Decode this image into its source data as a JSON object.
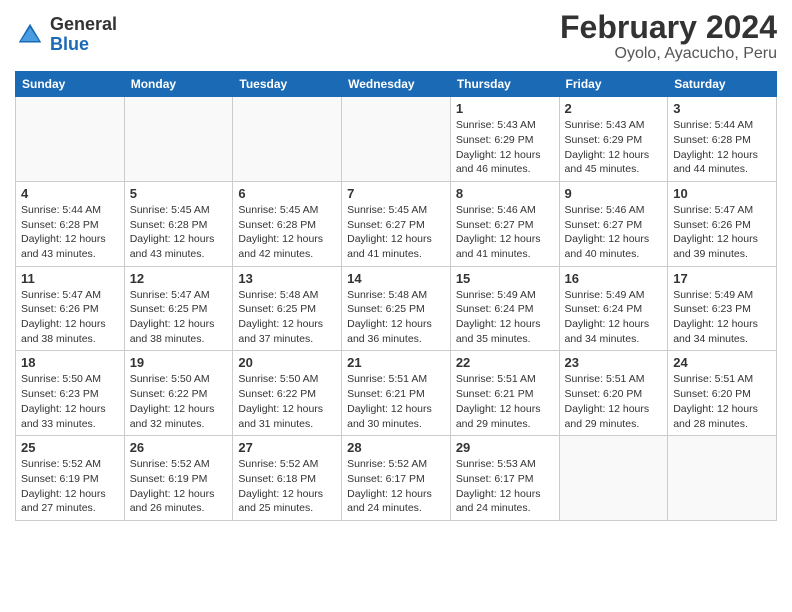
{
  "header": {
    "logo": {
      "general": "General",
      "blue": "Blue"
    },
    "title": "February 2024",
    "subtitle": "Oyolo, Ayacucho, Peru"
  },
  "calendar": {
    "weekdays": [
      "Sunday",
      "Monday",
      "Tuesday",
      "Wednesday",
      "Thursday",
      "Friday",
      "Saturday"
    ],
    "weeks": [
      [
        {
          "day": "",
          "info": ""
        },
        {
          "day": "",
          "info": ""
        },
        {
          "day": "",
          "info": ""
        },
        {
          "day": "",
          "info": ""
        },
        {
          "day": "1",
          "info": "Sunrise: 5:43 AM\nSunset: 6:29 PM\nDaylight: 12 hours\nand 46 minutes."
        },
        {
          "day": "2",
          "info": "Sunrise: 5:43 AM\nSunset: 6:29 PM\nDaylight: 12 hours\nand 45 minutes."
        },
        {
          "day": "3",
          "info": "Sunrise: 5:44 AM\nSunset: 6:28 PM\nDaylight: 12 hours\nand 44 minutes."
        }
      ],
      [
        {
          "day": "4",
          "info": "Sunrise: 5:44 AM\nSunset: 6:28 PM\nDaylight: 12 hours\nand 43 minutes."
        },
        {
          "day": "5",
          "info": "Sunrise: 5:45 AM\nSunset: 6:28 PM\nDaylight: 12 hours\nand 43 minutes."
        },
        {
          "day": "6",
          "info": "Sunrise: 5:45 AM\nSunset: 6:28 PM\nDaylight: 12 hours\nand 42 minutes."
        },
        {
          "day": "7",
          "info": "Sunrise: 5:45 AM\nSunset: 6:27 PM\nDaylight: 12 hours\nand 41 minutes."
        },
        {
          "day": "8",
          "info": "Sunrise: 5:46 AM\nSunset: 6:27 PM\nDaylight: 12 hours\nand 41 minutes."
        },
        {
          "day": "9",
          "info": "Sunrise: 5:46 AM\nSunset: 6:27 PM\nDaylight: 12 hours\nand 40 minutes."
        },
        {
          "day": "10",
          "info": "Sunrise: 5:47 AM\nSunset: 6:26 PM\nDaylight: 12 hours\nand 39 minutes."
        }
      ],
      [
        {
          "day": "11",
          "info": "Sunrise: 5:47 AM\nSunset: 6:26 PM\nDaylight: 12 hours\nand 38 minutes."
        },
        {
          "day": "12",
          "info": "Sunrise: 5:47 AM\nSunset: 6:25 PM\nDaylight: 12 hours\nand 38 minutes."
        },
        {
          "day": "13",
          "info": "Sunrise: 5:48 AM\nSunset: 6:25 PM\nDaylight: 12 hours\nand 37 minutes."
        },
        {
          "day": "14",
          "info": "Sunrise: 5:48 AM\nSunset: 6:25 PM\nDaylight: 12 hours\nand 36 minutes."
        },
        {
          "day": "15",
          "info": "Sunrise: 5:49 AM\nSunset: 6:24 PM\nDaylight: 12 hours\nand 35 minutes."
        },
        {
          "day": "16",
          "info": "Sunrise: 5:49 AM\nSunset: 6:24 PM\nDaylight: 12 hours\nand 34 minutes."
        },
        {
          "day": "17",
          "info": "Sunrise: 5:49 AM\nSunset: 6:23 PM\nDaylight: 12 hours\nand 34 minutes."
        }
      ],
      [
        {
          "day": "18",
          "info": "Sunrise: 5:50 AM\nSunset: 6:23 PM\nDaylight: 12 hours\nand 33 minutes."
        },
        {
          "day": "19",
          "info": "Sunrise: 5:50 AM\nSunset: 6:22 PM\nDaylight: 12 hours\nand 32 minutes."
        },
        {
          "day": "20",
          "info": "Sunrise: 5:50 AM\nSunset: 6:22 PM\nDaylight: 12 hours\nand 31 minutes."
        },
        {
          "day": "21",
          "info": "Sunrise: 5:51 AM\nSunset: 6:21 PM\nDaylight: 12 hours\nand 30 minutes."
        },
        {
          "day": "22",
          "info": "Sunrise: 5:51 AM\nSunset: 6:21 PM\nDaylight: 12 hours\nand 29 minutes."
        },
        {
          "day": "23",
          "info": "Sunrise: 5:51 AM\nSunset: 6:20 PM\nDaylight: 12 hours\nand 29 minutes."
        },
        {
          "day": "24",
          "info": "Sunrise: 5:51 AM\nSunset: 6:20 PM\nDaylight: 12 hours\nand 28 minutes."
        }
      ],
      [
        {
          "day": "25",
          "info": "Sunrise: 5:52 AM\nSunset: 6:19 PM\nDaylight: 12 hours\nand 27 minutes."
        },
        {
          "day": "26",
          "info": "Sunrise: 5:52 AM\nSunset: 6:19 PM\nDaylight: 12 hours\nand 26 minutes."
        },
        {
          "day": "27",
          "info": "Sunrise: 5:52 AM\nSunset: 6:18 PM\nDaylight: 12 hours\nand 25 minutes."
        },
        {
          "day": "28",
          "info": "Sunrise: 5:52 AM\nSunset: 6:17 PM\nDaylight: 12 hours\nand 24 minutes."
        },
        {
          "day": "29",
          "info": "Sunrise: 5:53 AM\nSunset: 6:17 PM\nDaylight: 12 hours\nand 24 minutes."
        },
        {
          "day": "",
          "info": ""
        },
        {
          "day": "",
          "info": ""
        }
      ]
    ]
  }
}
